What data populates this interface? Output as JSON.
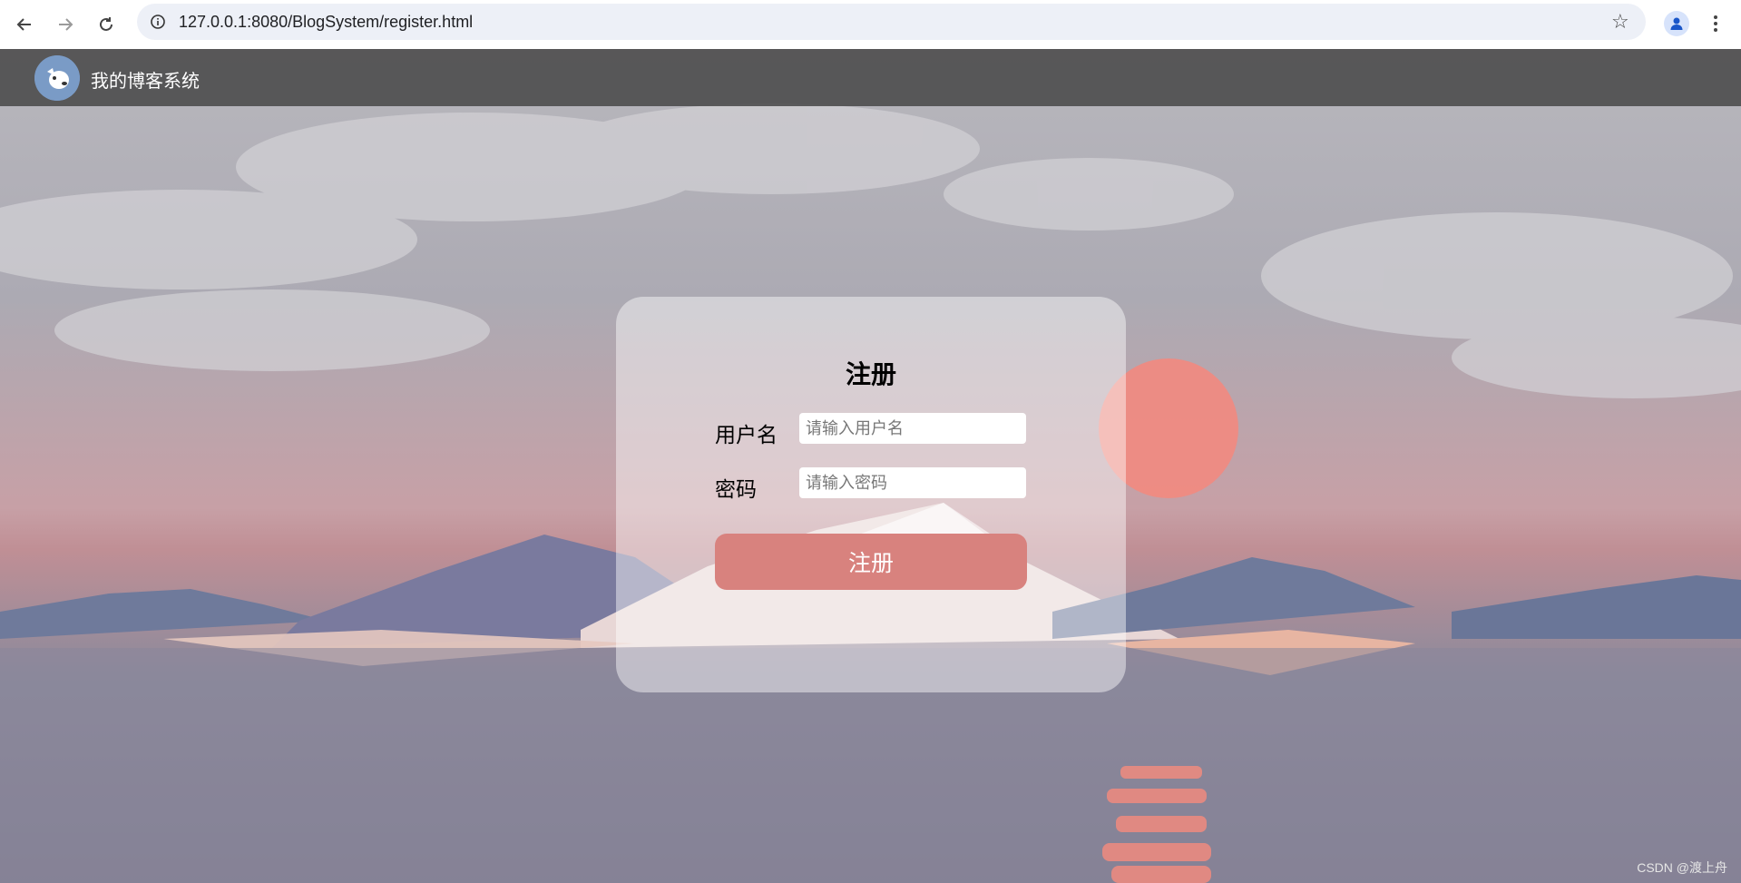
{
  "browser": {
    "url": "127.0.0.1:8080/BlogSystem/register.html"
  },
  "nav": {
    "site_title": "我的博客系统"
  },
  "register": {
    "title": "注册",
    "username_label": "用户名",
    "username_placeholder": "请输入用户名",
    "username_value": "",
    "password_label": "密码",
    "password_placeholder": "请输入密码",
    "password_value": "",
    "submit_label": "注册"
  },
  "watermark": "CSDN @渡上舟",
  "colors": {
    "nav_bg": "#464646",
    "button": "#d8827e",
    "card": "#ffffff"
  }
}
